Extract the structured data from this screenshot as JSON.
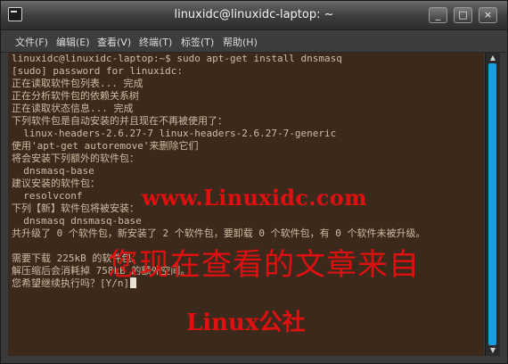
{
  "window": {
    "title": "linuxidc@linuxidc-laptop: ~",
    "buttons": {
      "minimize": "_",
      "maximize": "□",
      "close": "×"
    }
  },
  "menubar": {
    "items": [
      "文件(F)",
      "编辑(E)",
      "查看(V)",
      "终端(T)",
      "标签(T)",
      "帮助(H)"
    ]
  },
  "terminal": {
    "lines": [
      "linuxidc@linuxidc-laptop:~$ sudo apt-get install dnsmasq",
      "[sudo] password for linuxidc:",
      "正在读取软件包列表... 完成",
      "正在分析软件包的依赖关系树",
      "正在读取状态信息... 完成",
      "下列软件包是自动安装的并且现在不再被使用了：",
      "  linux-headers-2.6.27-7 linux-headers-2.6.27-7-generic",
      "使用'apt-get autoremove'来删除它们",
      "将会安装下列额外的软件包：",
      "  dnsmasq-base",
      "建议安装的软件包：",
      "  resolvconf",
      "下列【新】软件包将被安装：",
      "  dnsmasq dnsmasq-base",
      "共升级了 0 个软件包，新安装了 2 个软件包，要卸载 0 个软件包，有 0 个软件未被升级。",
      "",
      "需要下载 225kB 的软件包。",
      "解压缩后会消耗掉 758kB 的额外空间。",
      "您希望继续执行吗？[Y/n]"
    ]
  },
  "watermark": {
    "url": "www.Linuxidc.com",
    "chinese": "您现在查看的文章来自",
    "brand": "Linux公社"
  },
  "colors": {
    "terminal_bg": "#3b2a1c",
    "terminal_fg": "#cdbda4",
    "scrollbar_thumb": "#1a9ee0",
    "watermark": "#e01010"
  }
}
